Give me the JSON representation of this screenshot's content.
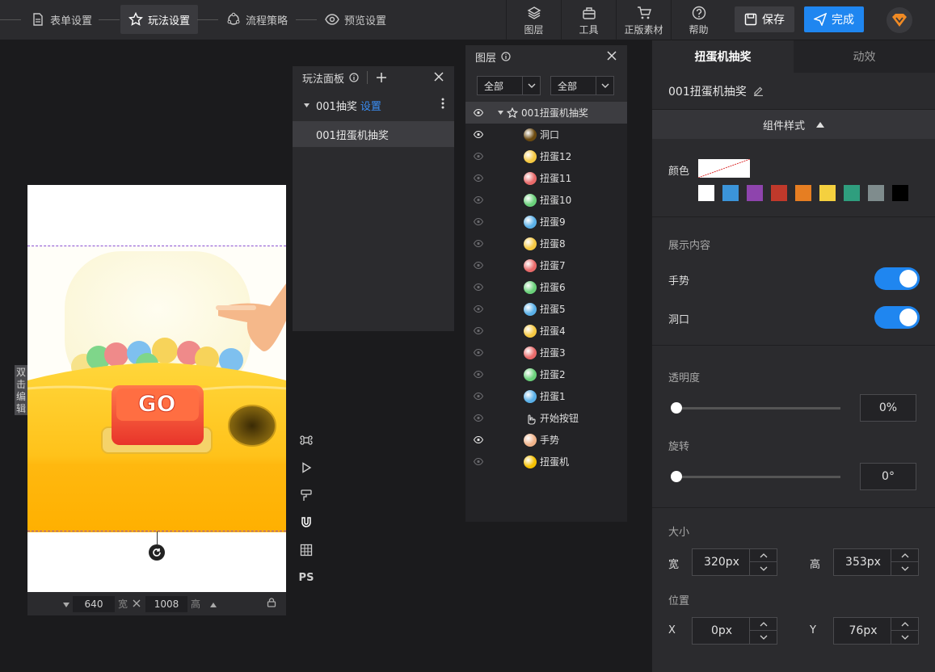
{
  "steps": [
    {
      "label": "表单设置",
      "icon": "document-icon"
    },
    {
      "label": "玩法设置",
      "icon": "star-icon"
    },
    {
      "label": "流程策略",
      "icon": "flow-icon"
    },
    {
      "label": "预览设置",
      "icon": "eye-icon"
    }
  ],
  "tools": [
    {
      "label": "图层",
      "icon": "layers-icon"
    },
    {
      "label": "工具",
      "icon": "toolbox-icon"
    },
    {
      "label": "正版素材",
      "icon": "cart-icon"
    },
    {
      "label": "帮助",
      "icon": "help-icon"
    }
  ],
  "save_label": "保存",
  "done_label": "完成",
  "canvas": {
    "side_tab": "双击编辑",
    "go_text": "GO",
    "width": "640",
    "width_label": "宽",
    "height": "1008",
    "height_label": "高",
    "vtool_ps": "PS"
  },
  "play_panel": {
    "title": "玩法面板",
    "group": "001抽奖",
    "group_link": "设置",
    "item": "001扭蛋机抽奖"
  },
  "layers": {
    "title": "图层",
    "filter1": "全部",
    "filter2": "全部",
    "root": "001扭蛋机抽奖",
    "items": [
      {
        "name": "洞口",
        "color": "#6b4a10",
        "visible": true
      },
      {
        "name": "扭蛋12",
        "color": "#f5c842"
      },
      {
        "name": "扭蛋11",
        "color": "#e86a6a"
      },
      {
        "name": "扭蛋10",
        "color": "#6ad07a"
      },
      {
        "name": "扭蛋9",
        "color": "#5ab0e8"
      },
      {
        "name": "扭蛋8",
        "color": "#f5c842"
      },
      {
        "name": "扭蛋7",
        "color": "#e86a6a"
      },
      {
        "name": "扭蛋6",
        "color": "#6ad07a"
      },
      {
        "name": "扭蛋5",
        "color": "#5ab0e8"
      },
      {
        "name": "扭蛋4",
        "color": "#f5c842"
      },
      {
        "name": "扭蛋3",
        "color": "#e86a6a"
      },
      {
        "name": "扭蛋2",
        "color": "#6ad07a"
      },
      {
        "name": "扭蛋1",
        "color": "#5ab0e8"
      },
      {
        "name": "开始按钮",
        "color": "none"
      },
      {
        "name": "手势",
        "color": "#f0b38a",
        "visible": true
      },
      {
        "name": "扭蛋机",
        "color": "#f5c000"
      }
    ]
  },
  "right": {
    "tab1": "扭蛋机抽奖",
    "tab2": "动效",
    "comp_name": "001扭蛋机抽奖",
    "section": "组件样式",
    "color_label": "颜色",
    "swatches": [
      "#ffffff",
      "#3b94d9",
      "#8e44ad",
      "#c0392b",
      "#e67e22",
      "#f4d03f",
      "#2f9e7e",
      "#7f8c8d",
      "#000000"
    ],
    "display_label": "展示内容",
    "gesture_label": "手势",
    "hole_label": "洞口",
    "opacity_label": "透明度",
    "opacity_value": "0%",
    "rotate_label": "旋转",
    "rotate_value": "0°",
    "size_label": "大小",
    "w_label": "宽",
    "w_value": "320px",
    "h_label": "高",
    "h_value": "353px",
    "pos_label": "位置",
    "x_label": "X",
    "x_value": "0px",
    "y_label": "Y",
    "y_value": "76px"
  }
}
